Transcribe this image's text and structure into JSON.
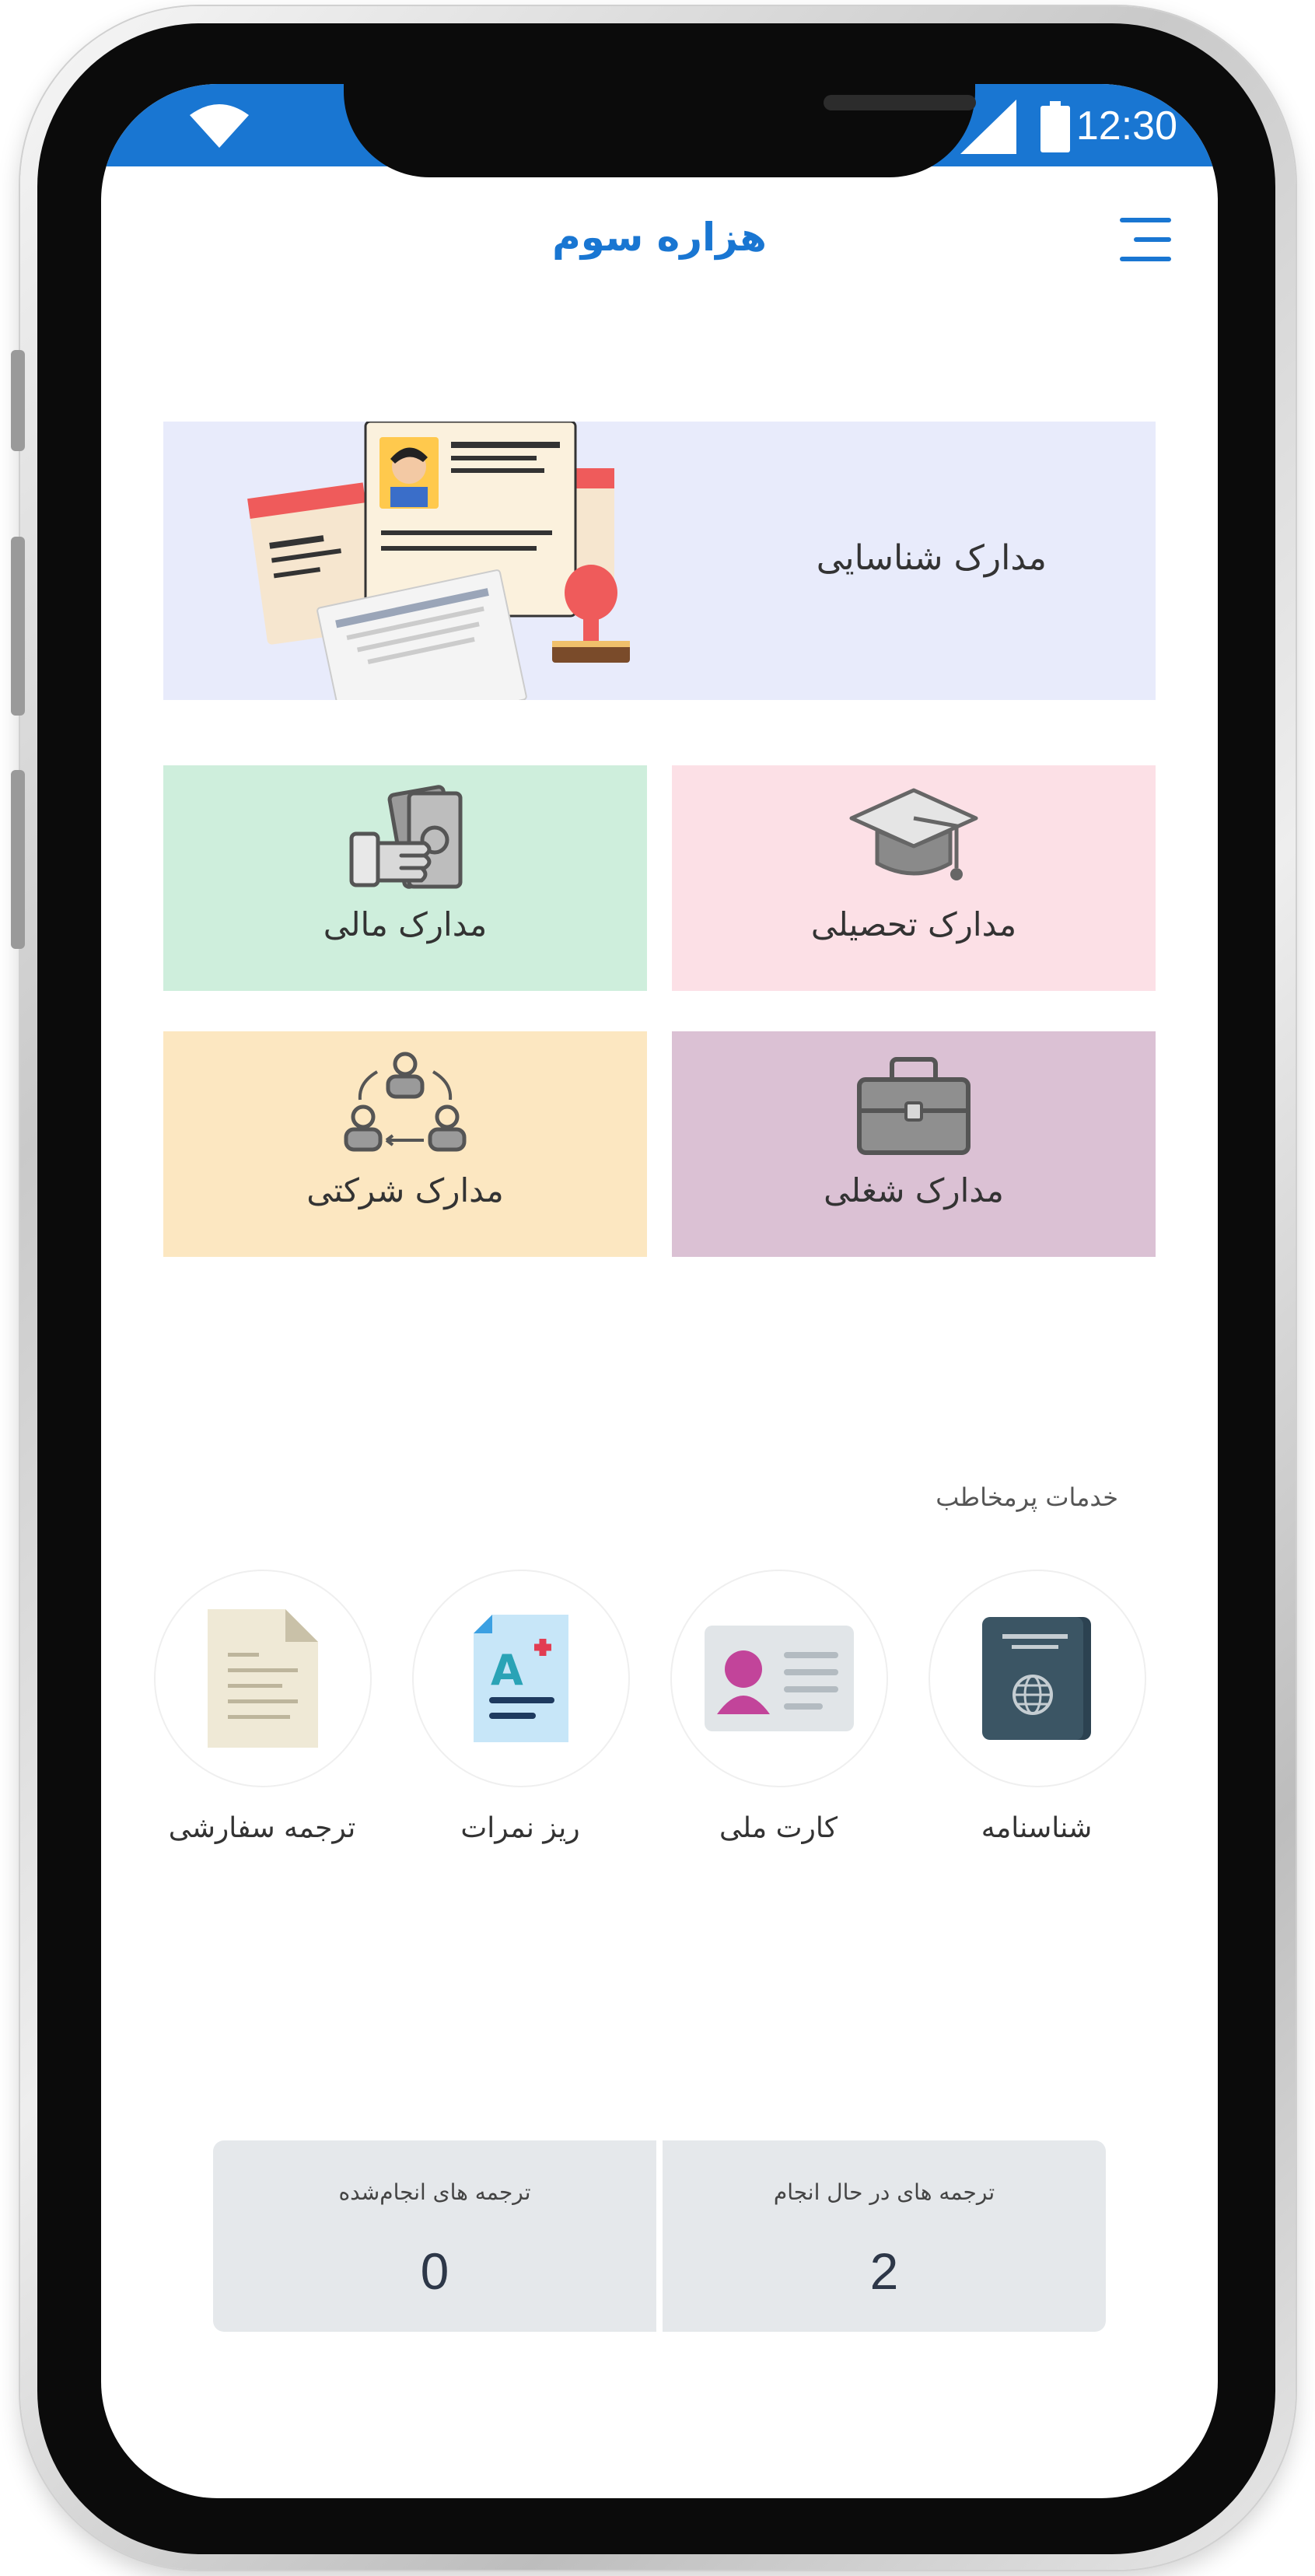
{
  "status_bar": {
    "time": "12:30",
    "wifi_icon": "wifi-icon",
    "signal_icon": "signal-icon",
    "battery_icon": "battery-icon"
  },
  "header": {
    "title": "هزاره سوم",
    "menu_icon": "hamburger-menu-icon"
  },
  "banner": {
    "label": "مدارک شناسایی",
    "image": "identity-documents-illustration"
  },
  "cards": {
    "academic": {
      "label": "مدارک تحصیلی",
      "icon": "graduation-cap-icon",
      "color": "#fce0e6"
    },
    "finance": {
      "label": "مدارک مالی",
      "icon": "money-hand-icon",
      "color": "#ceeedc"
    },
    "job": {
      "label": "مدارک شغلی",
      "icon": "briefcase-icon",
      "color": "#dbc1d4"
    },
    "company": {
      "label": "مدارک شرکتی",
      "icon": "team-cycle-icon",
      "color": "#fce7c1"
    }
  },
  "popular": {
    "title": "خدمات پرمخاطب",
    "items": [
      {
        "label": "شناسنامه",
        "icon": "passport-icon"
      },
      {
        "label": "کارت ملی",
        "icon": "id-card-icon"
      },
      {
        "label": "ریز نمرات",
        "icon": "transcript-icon"
      },
      {
        "label": "ترجمه سفارشی",
        "icon": "document-icon"
      }
    ]
  },
  "stats": {
    "in_progress": {
      "label": "ترجمه های در حال انجام",
      "value": "2"
    },
    "done": {
      "label": "ترجمه های انجام‌شده",
      "value": "0"
    }
  },
  "colors": {
    "accent": "#1976d2",
    "stat_bg": "#e5e8eb"
  }
}
